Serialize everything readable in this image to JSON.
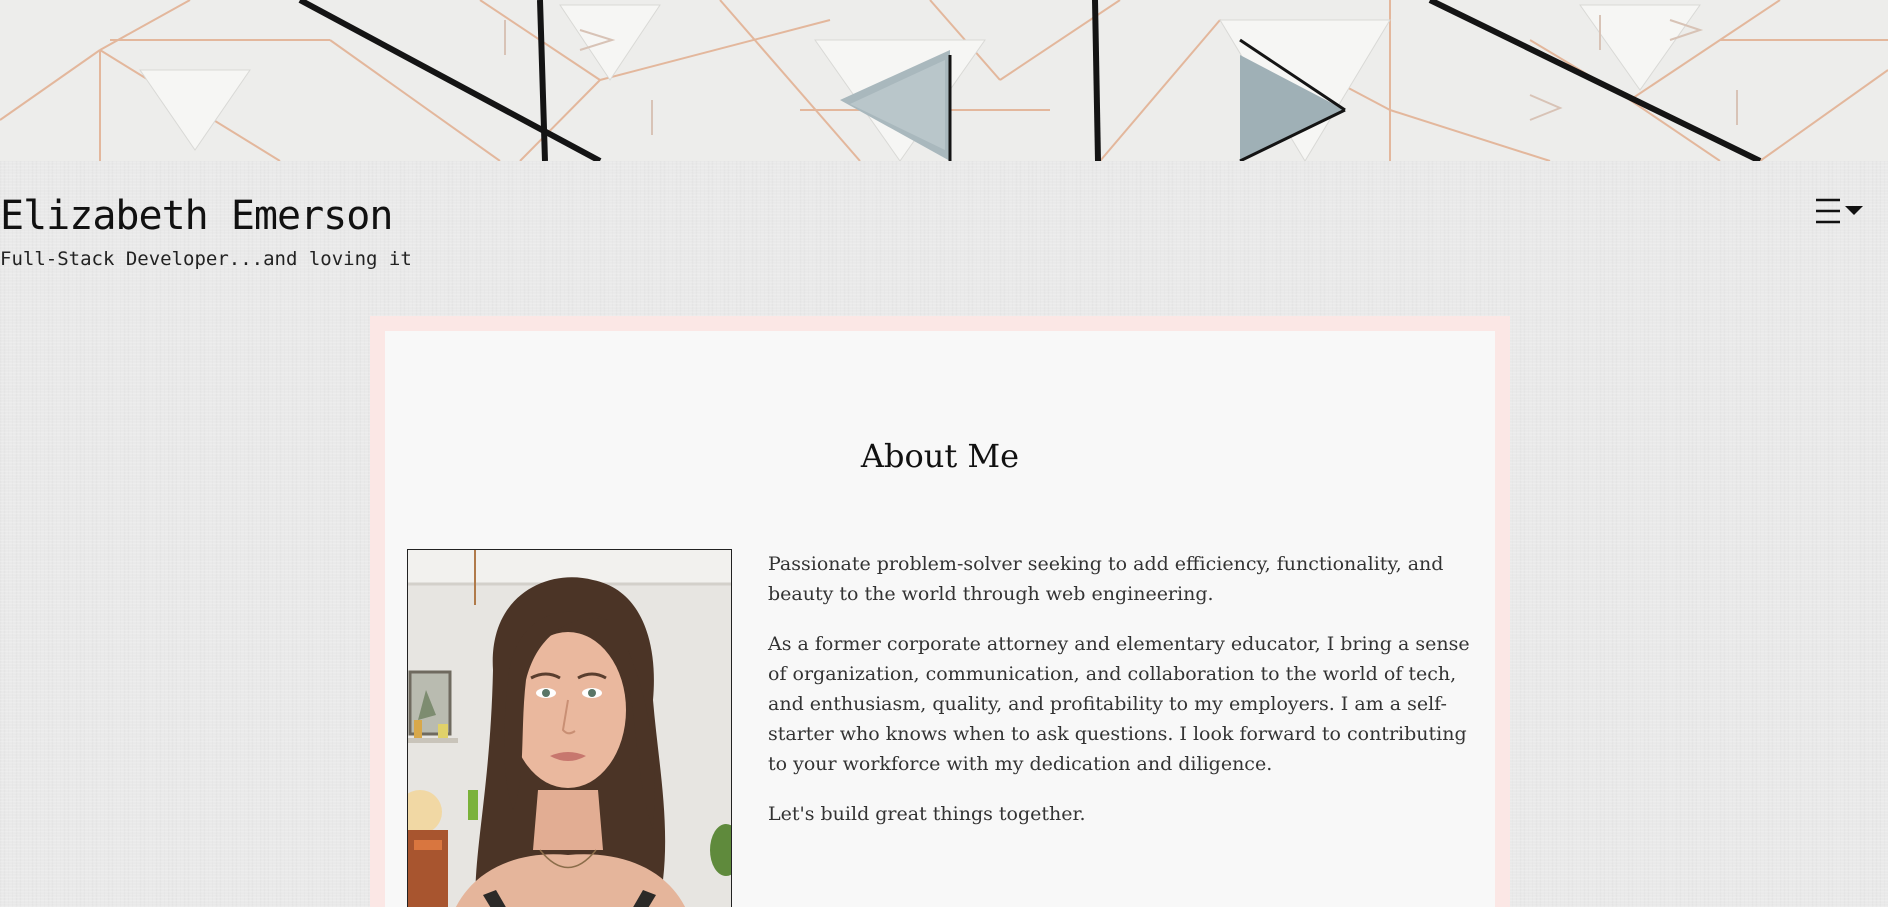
{
  "header": {
    "title": "Elizabeth Emerson",
    "tagline": "Full-Stack Developer...and loving it",
    "menu_icon": "hamburger-menu-icon"
  },
  "about": {
    "heading": "About Me",
    "paragraphs": [
      "Passionate problem-solver seeking to add efficiency, functionality, and beauty to the world through web engineering.",
      "As a former corporate attorney and elementary educator, I bring a sense of organization, communication, and collaboration to the world of tech, and enthusiasm, quality, and profitability to my employers. I am a self-starter who knows when to ask questions. I look forward to contributing to your workforce with my dedication and diligence.",
      "Let's build great things together."
    ]
  },
  "colors": {
    "page_background": "#e9e9e9",
    "card_frame": "#fbe7e5",
    "card_background": "#f8f8f8",
    "text": "#333333"
  }
}
